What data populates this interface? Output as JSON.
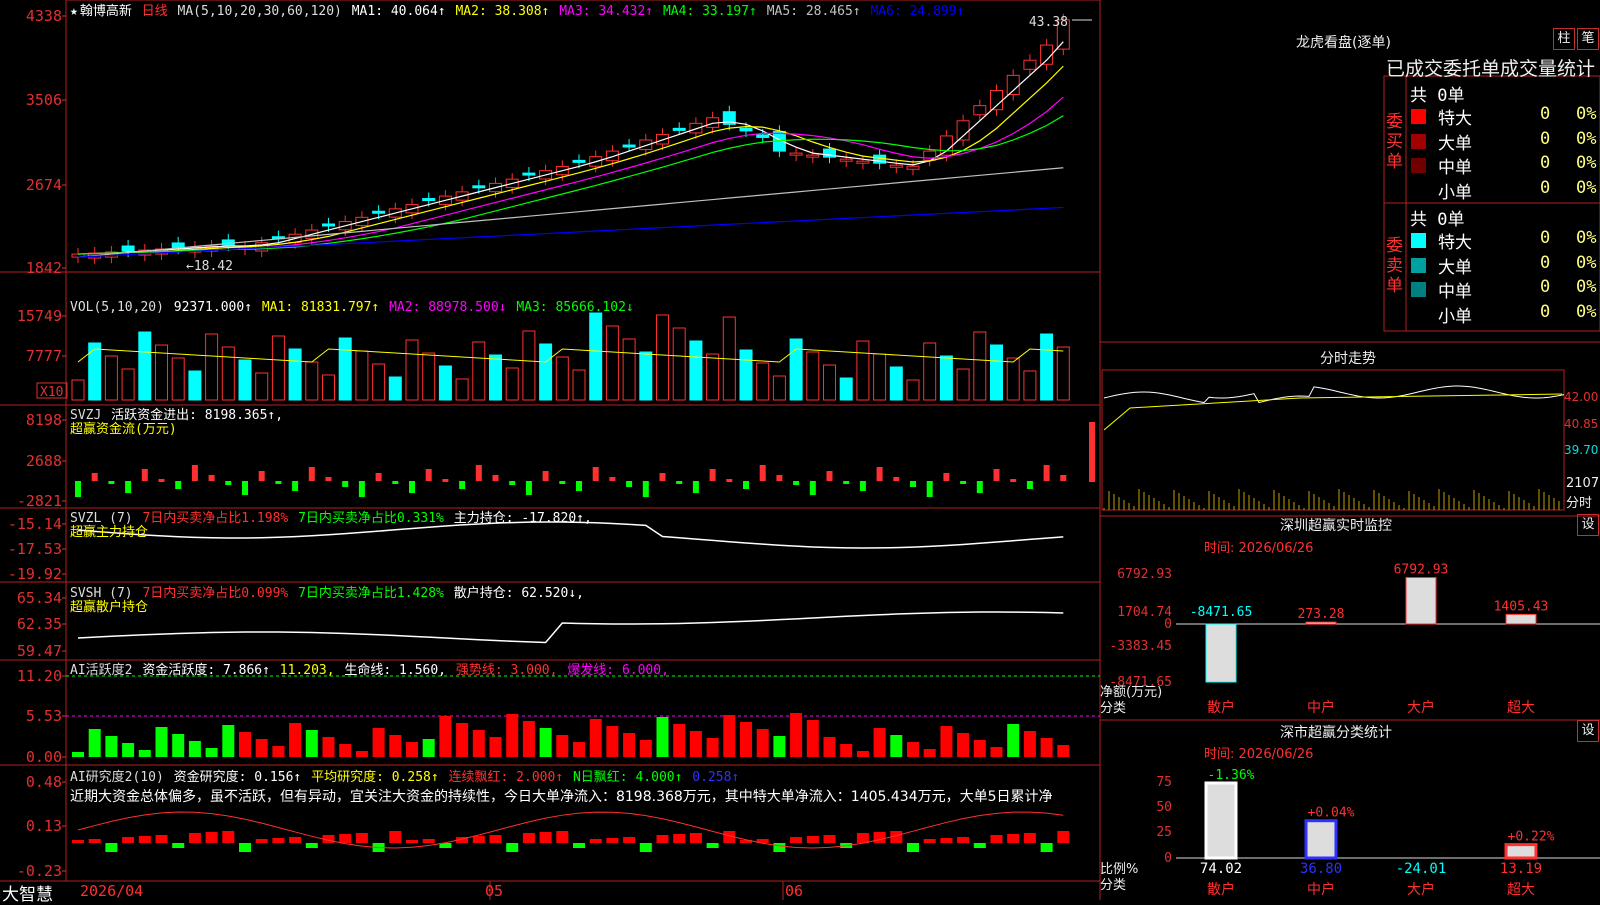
{
  "app_name": "大智慧",
  "main": {
    "star": "★",
    "stock_name": "翰博高新",
    "period": "日线",
    "ma_params": "MA(5,10,20,30,60,120)",
    "ma": [
      {
        "label": "MA1:",
        "value": "40.064↑",
        "color": "#ffffff"
      },
      {
        "label": "MA2:",
        "value": "38.308↑",
        "color": "#ffff00"
      },
      {
        "label": "MA3:",
        "value": "34.432↑",
        "color": "#ff00ff"
      },
      {
        "label": "MA4:",
        "value": "33.197↑",
        "color": "#00ff00"
      },
      {
        "label": "MA5:",
        "value": "28.465↑",
        "color": "#c0c0c0"
      },
      {
        "label": "MA6:",
        "value": "24.899↑",
        "color": "#0000ff"
      }
    ],
    "y_labels": [
      "4338",
      "3506",
      "2674",
      "1842"
    ],
    "high_marker": "43.38",
    "low_marker": "18.42"
  },
  "vol": {
    "title": "VOL(5,10,20)",
    "value": "92371.000↑",
    "ma1": "MA1: 81831.797↑",
    "ma2": "MA2: 88978.500↓",
    "ma3": "MA3: 85666.102↓",
    "y_labels": [
      "15749",
      "7777"
    ],
    "unit": "X10"
  },
  "svzj": {
    "title": "SVZJ",
    "line1": "活跃资金进出: 8198.365↑,",
    "line2": "超赢资金流(万元)",
    "y_labels": [
      "8198",
      "2688",
      "-2821"
    ]
  },
  "svzl": {
    "title": "SVZL (7)",
    "a": "7日内买卖净占比1.198%",
    "b": "7日内买卖净占比0.331%",
    "c": "主力持仓: -17.820↑,",
    "sub": "超赢主力持仓",
    "y_labels": [
      "-15.14",
      "-17.53",
      "-19.92"
    ]
  },
  "svsh": {
    "title": "SVSH (7)",
    "a": "7日内买卖净占比0.099%",
    "b": "7日内买卖净占比1.428%",
    "c": "散户持仓: 62.520↓,",
    "sub": "超赢散户持仓",
    "y_labels": [
      "65.34",
      "62.35",
      "59.47"
    ]
  },
  "ai_active": {
    "title": "AI活跃度2",
    "a": "资金活跃度: 7.866↑",
    "b": "11.203,",
    "c": "生命线: 1.560,",
    "d": "强势线: 3.000,",
    "e": "爆发线: 6.000,",
    "y_labels": [
      "11.20",
      "5.53",
      "0.00"
    ]
  },
  "ai_research": {
    "title": "AI研究度2(10)",
    "a": "资金研究度: 0.156↑",
    "b": "平均研究度: 0.258↑",
    "c": "连续飘红: 2.000↑",
    "d": "N日飘红: 4.000↑",
    "e": "0.258↑",
    "comment": "近期大资金总体偏多，虽不活跃，但有异动，宜关注大资金的持续性，今日大单净流入：8198.368万元，其中特大单净流入：1405.434万元，大单5日累计净",
    "y_labels": [
      "0.48",
      "0.13",
      "-0.23"
    ]
  },
  "x_axis": {
    "labels": [
      "2026/04",
      "05",
      "06"
    ]
  },
  "right": {
    "lhb_title": "龙虎看盘(逐单)",
    "btn_bar": "柱",
    "btn_pen": "笔",
    "stat_title": "已成交委托单成交量统计",
    "buy_side_label": "委买单",
    "sell_side_label": "委卖单",
    "buy_total": "共 0单",
    "sell_total": "共 0单",
    "buy_rows": [
      {
        "name": "特大",
        "n": "0",
        "pct": "0%",
        "color": "#ff0000"
      },
      {
        "name": "大单",
        "n": "0",
        "pct": "0%",
        "color": "#a00000"
      },
      {
        "name": "中单",
        "n": "0",
        "pct": "0%",
        "color": "#700000"
      },
      {
        "name": "小单",
        "n": "0",
        "pct": "0%",
        "color": ""
      }
    ],
    "sell_rows": [
      {
        "name": "特大",
        "n": "0",
        "pct": "0%",
        "color": "#00ffff"
      },
      {
        "name": "大单",
        "n": "0",
        "pct": "0%",
        "color": "#00a0a0"
      },
      {
        "name": "中单",
        "n": "0",
        "pct": "0%",
        "color": "#008080"
      },
      {
        "name": "小单",
        "n": "0",
        "pct": "0%",
        "color": ""
      }
    ],
    "intraday_title": "分时走势",
    "intraday_labels": [
      "42.00",
      "40.85",
      "39.70"
    ],
    "intraday_vol_label": "2107",
    "intraday_vol_unit": "分时",
    "sz_title": "深圳超赢实时监控",
    "sz_btn": "设",
    "sz_time": "时间: 2026/06/26",
    "sz_y_labels": [
      "6792.93",
      "1704.74",
      "0",
      "-3383.45",
      "-8471.65"
    ],
    "sz_bars": [
      {
        "cat": "散户",
        "value": -8471.65,
        "label": "-8471.65"
      },
      {
        "cat": "中户",
        "value": 273.28,
        "label": "273.28"
      },
      {
        "cat": "大户",
        "value": 6792.93,
        "label": "6792.93"
      },
      {
        "cat": "超大",
        "value": 1405.43,
        "label": "1405.43"
      }
    ],
    "sz_ylabel": "净额(万元)",
    "sz_xlabel": "分类",
    "sh_title": "深市超赢分类统计",
    "sh_btn": "设",
    "sh_time": "时间: 2026/06/26",
    "sh_y_labels": [
      "75",
      "50",
      "25",
      "0"
    ],
    "sh_bars": [
      {
        "cat": "散户",
        "value": 74.02,
        "change": "-1.36%",
        "bottom": "74.02",
        "color": "#00ff00",
        "bcolor": "#ffffff"
      },
      {
        "cat": "中户",
        "value": 36.8,
        "change": "+0.04%",
        "bottom": "36.80",
        "color": "#ff3030",
        "bcolor": "#3030ff"
      },
      {
        "cat": "大户",
        "value": -24.01,
        "change": "",
        "bottom": "-24.01",
        "color": "",
        "bcolor": "#00ffff"
      },
      {
        "cat": "超大",
        "value": 13.19,
        "change": "+0.22%",
        "bottom": "13.19",
        "color": "#ff3030",
        "bcolor": "#ff3030"
      }
    ],
    "sh_ylabel": "比例%",
    "sh_xlabel": "分类"
  }
}
